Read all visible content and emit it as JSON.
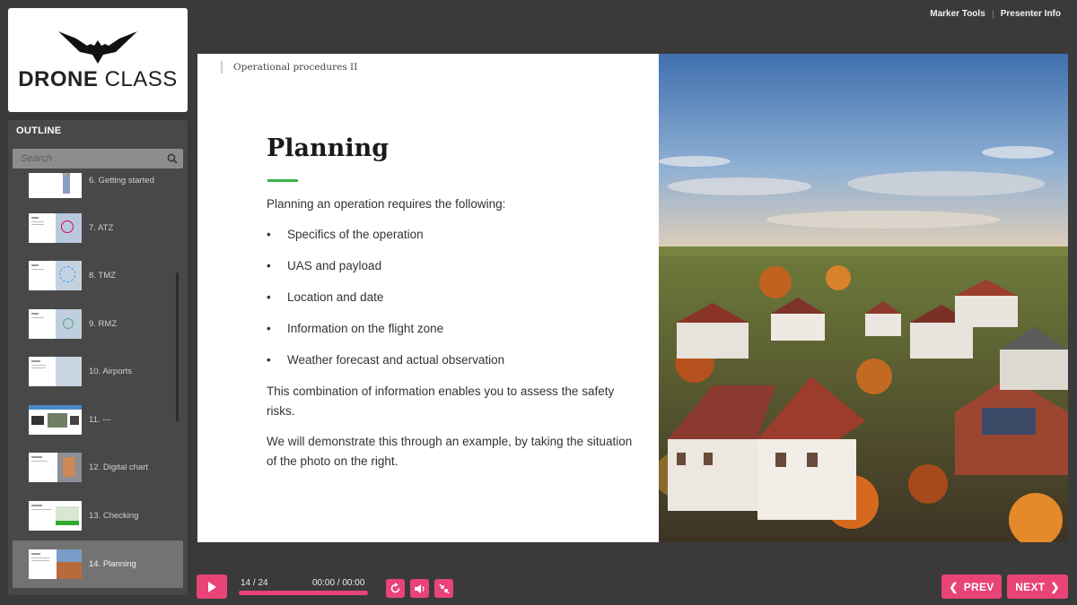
{
  "logo": {
    "brand_bold": "DRONE",
    "brand_light": "CLASS"
  },
  "outline": {
    "title": "OUTLINE",
    "search_placeholder": "Search",
    "items": [
      {
        "label": "6. Getting started"
      },
      {
        "label": "7. ATZ"
      },
      {
        "label": "8. TMZ"
      },
      {
        "label": "9. RMZ"
      },
      {
        "label": "10. Airports"
      },
      {
        "label": "11. ---"
      },
      {
        "label": "12. Digital chart"
      },
      {
        "label": "13. Checking"
      },
      {
        "label": "14. Planning",
        "active": true
      }
    ]
  },
  "top_links": {
    "marker_tools": "Marker Tools",
    "presenter_info": "Presenter Info"
  },
  "slide": {
    "section": "Operational procedures II",
    "heading": "Planning",
    "intro": "Planning an operation requires the following:",
    "bullets": [
      "Specifics of the operation",
      "UAS and payload",
      "Location and date",
      "Information on the flight zone",
      "Weather forecast and actual observation"
    ],
    "para1": "This combination of information enables you to assess the safety risks.",
    "para2": "We will demonstrate this through an example, by taking the situation of the photo on the right."
  },
  "player": {
    "slide_counter": "14 / 24",
    "time": "00:00 / 00:00",
    "progress": 1.0,
    "prev_label": "PREV",
    "next_label": "NEXT"
  },
  "colors": {
    "accent": "#e84478",
    "heading_underline": "#3cb44a"
  }
}
